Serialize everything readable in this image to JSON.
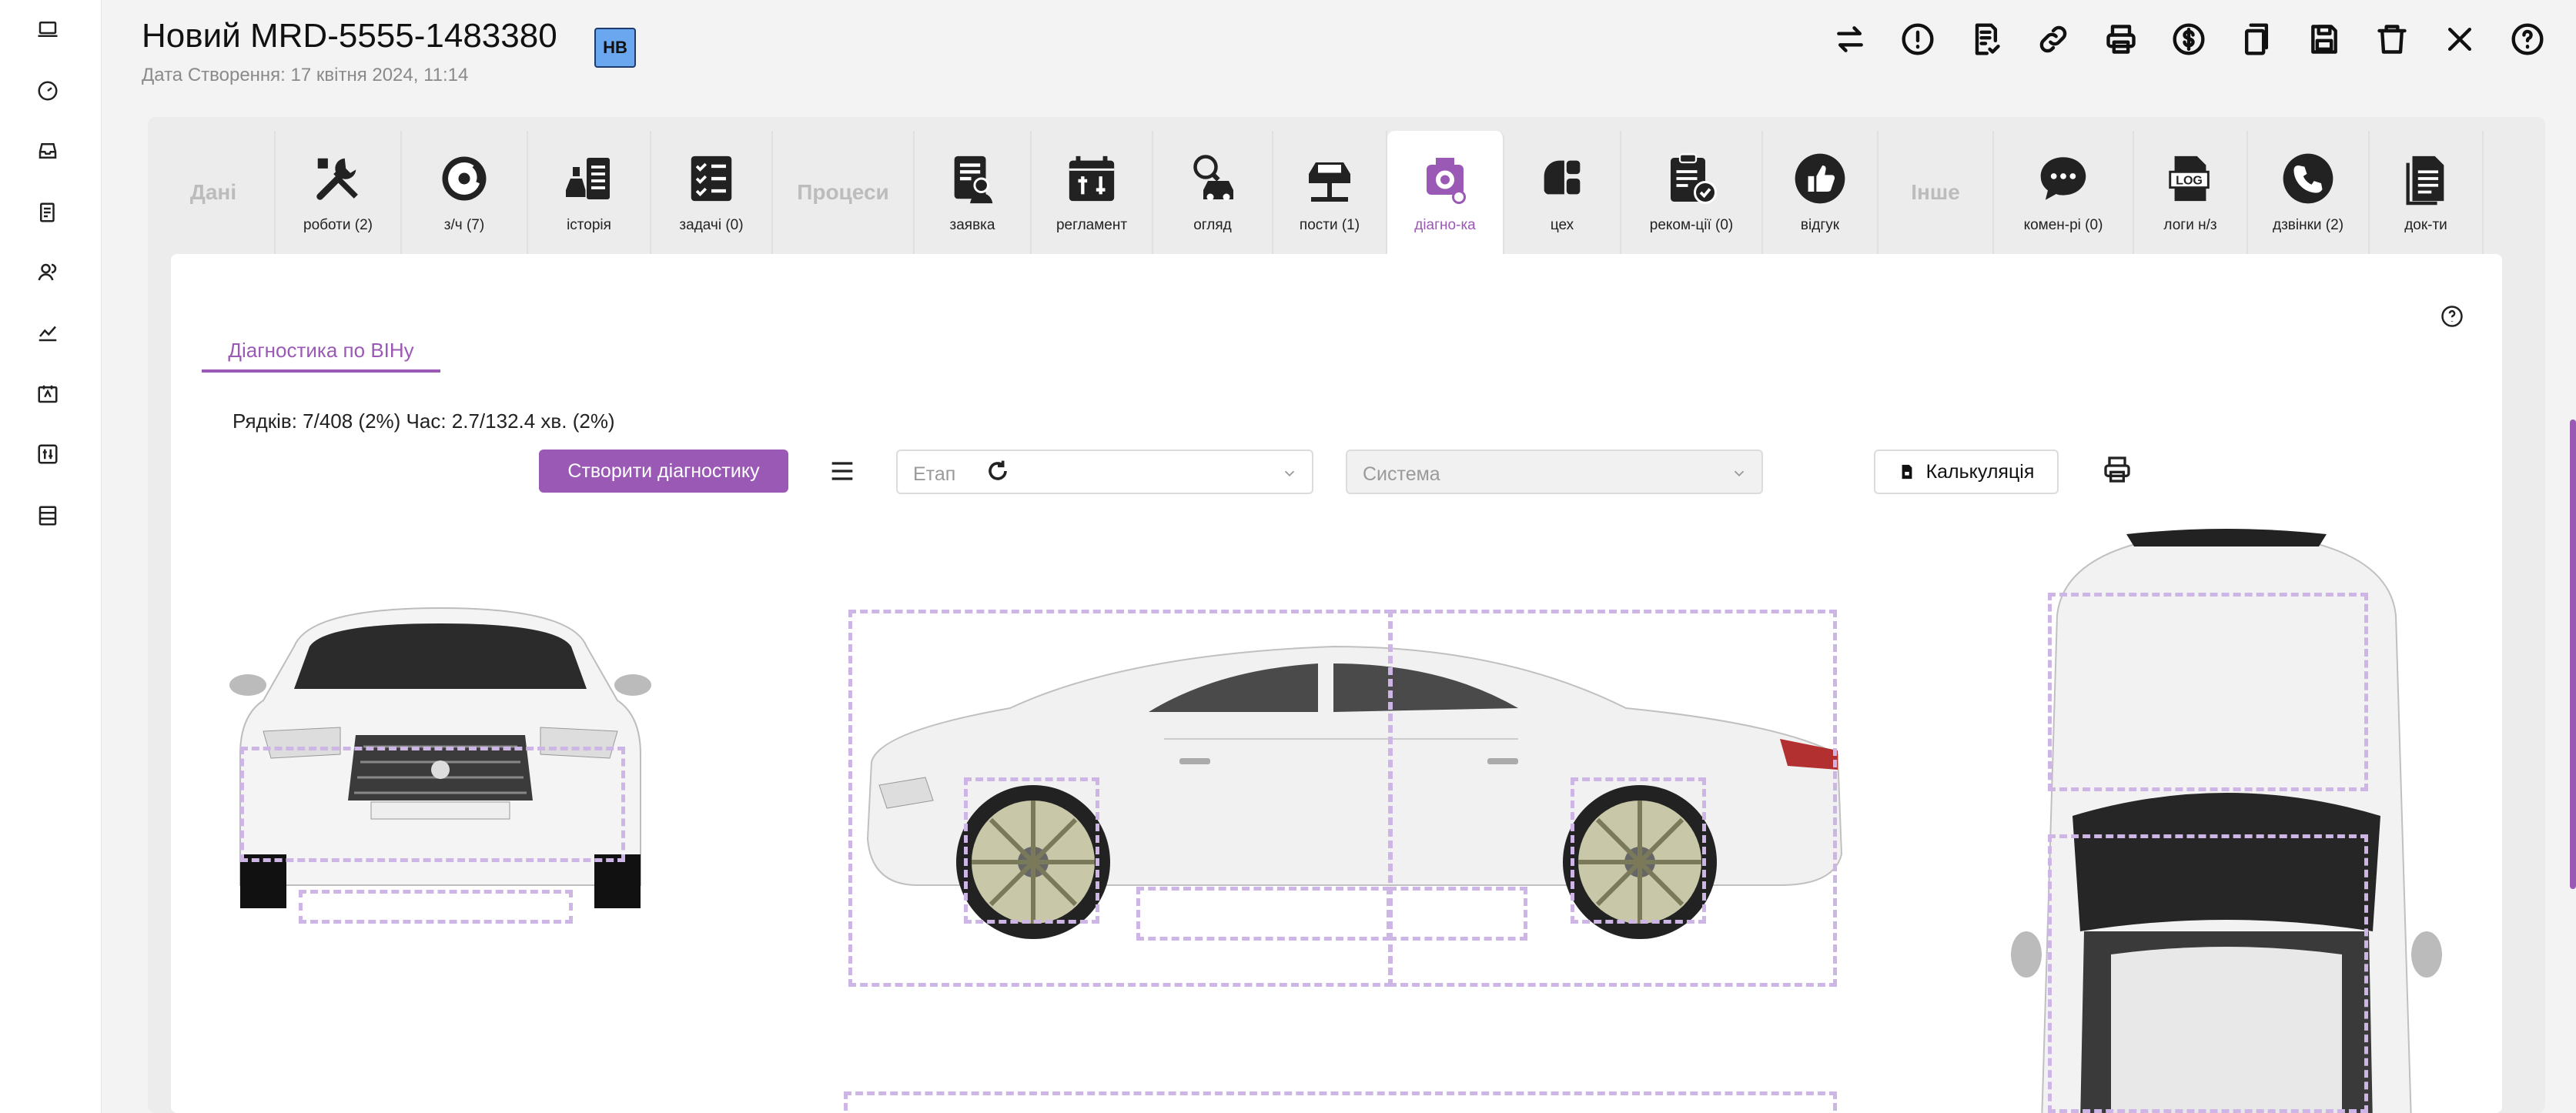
{
  "sidebar": {
    "items": [
      {
        "icon": "laptop-icon"
      },
      {
        "icon": "speedometer-icon"
      },
      {
        "icon": "inbox-icon"
      },
      {
        "icon": "document-icon"
      },
      {
        "icon": "users-icon"
      },
      {
        "icon": "chart-icon"
      },
      {
        "icon": "calendar-icon"
      },
      {
        "icon": "sliders-icon"
      },
      {
        "icon": "list-icon"
      }
    ]
  },
  "header": {
    "title": "Новий MRD-5555-1483380",
    "subtitle": "Дата Створення: 17 квітня 2024, 11:14",
    "badge": "НВ",
    "actions": [
      "swap-icon",
      "alert-icon",
      "doc-check-icon",
      "link-icon",
      "print-icon",
      "dollar-icon",
      "copy-icon",
      "save-icon",
      "trash-icon",
      "close-icon",
      "help-icon"
    ]
  },
  "tabs": {
    "section_data": "Дані",
    "section_process": "Процеси",
    "section_other": "Інше",
    "items": {
      "works": "роботи (2)",
      "parts": "з/ч (7)",
      "history": "історія",
      "tasks": "задачі (0)",
      "request": "заявка",
      "regulation": "регламент",
      "inspection": "огляд",
      "posts": "пости (1)",
      "diagnostics": "діагно-ка",
      "workshop": "цех",
      "recommendations": "реком-ції (0)",
      "feedback": "відгук",
      "comments": "комен-рі (0)",
      "logs": "логи н/з",
      "calls": "дзвінки (2)",
      "documents": "док-ти"
    },
    "active": "diagnostics"
  },
  "panel": {
    "subtab": "Діагностика по ВІНу",
    "stats": "Рядків: 7/408 (2%) Час: 2.7/132.4 хв. (2%)",
    "create_button": "Створити діагностику",
    "stage_placeholder": "Етап",
    "system_placeholder": "Система",
    "calc_button": "Калькуляція"
  },
  "colors": {
    "accent": "#9b59b6",
    "badge": "#6aa7ee",
    "dash": "#cdb6e6"
  }
}
